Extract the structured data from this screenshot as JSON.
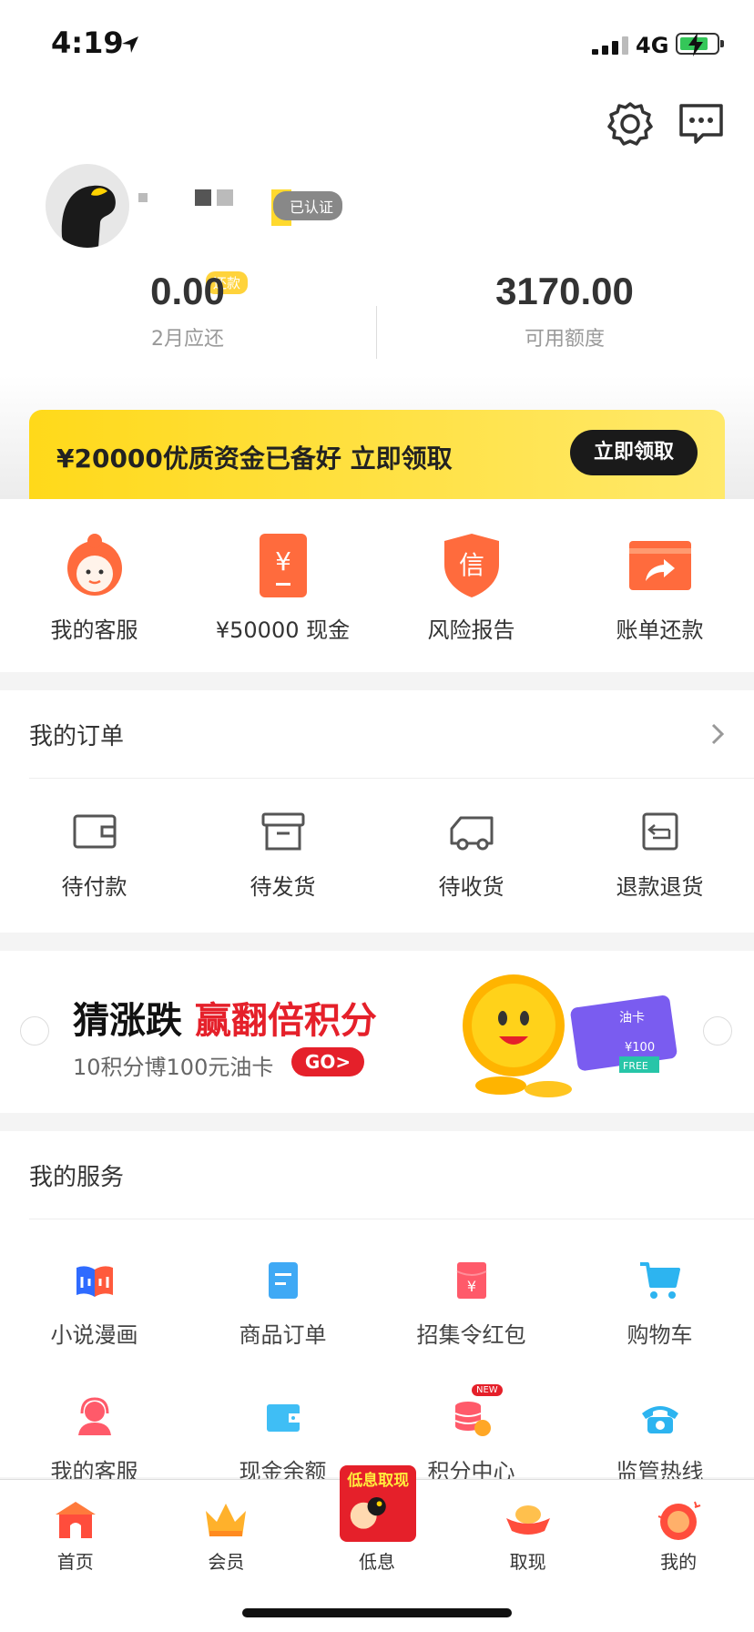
{
  "status_bar": {
    "time": "4:19",
    "network": "4G"
  },
  "profile": {
    "verified_label": "已认证"
  },
  "stats": {
    "repay_badge": "还款",
    "due_amount": "0.00",
    "due_label": "2月应还",
    "credit_amount": "3170.00",
    "credit_label": "可用额度"
  },
  "promo": {
    "text": "¥20000优质资金已备好 立即领取",
    "button": "立即领取"
  },
  "tools": [
    {
      "label": "我的客服",
      "icon": "customer-service-icon"
    },
    {
      "label": "¥50000 现金",
      "icon": "cash-icon"
    },
    {
      "label": "风险报告",
      "icon": "risk-shield-icon"
    },
    {
      "label": "账单还款",
      "icon": "bill-repay-icon"
    }
  ],
  "orders": {
    "title": "我的订单",
    "items": [
      {
        "label": "待付款",
        "icon": "wallet-icon"
      },
      {
        "label": "待发货",
        "icon": "box-icon"
      },
      {
        "label": "待收货",
        "icon": "truck-icon"
      },
      {
        "label": "退款退货",
        "icon": "refund-icon"
      }
    ]
  },
  "banner": {
    "title_black": "猜涨跌 ",
    "title_red": "赢翻倍积分",
    "subtitle": "10积分博100元油卡",
    "go": "GO>",
    "card_label": "油卡",
    "card_amount": "¥100",
    "card_free": "FREE"
  },
  "services": {
    "title": "我的服务",
    "items": [
      {
        "label": "小说漫画",
        "icon": "novel-comic-icon"
      },
      {
        "label": "商品订单",
        "icon": "order-doc-icon"
      },
      {
        "label": "招集令红包",
        "icon": "red-envelope-icon"
      },
      {
        "label": "购物车",
        "icon": "shopping-cart-icon"
      },
      {
        "label": "我的客服",
        "icon": "headset-icon"
      },
      {
        "label": "现金余额",
        "icon": "wallet-balance-icon"
      },
      {
        "label": "积分中心",
        "icon": "points-icon",
        "badge": "NEW"
      },
      {
        "label": "监管热线",
        "icon": "phone-icon"
      }
    ]
  },
  "tabbar": [
    {
      "label": "首页",
      "icon": "home-icon"
    },
    {
      "label": "会员",
      "icon": "crown-icon"
    },
    {
      "label": "低息",
      "icon": "low-interest-icon",
      "promo": "低息取现"
    },
    {
      "label": "取现",
      "icon": "gold-ingot-icon"
    },
    {
      "label": "我的",
      "icon": "profile-icon"
    }
  ],
  "colors": {
    "accent": "#ffd91a",
    "red": "#e5202a",
    "orange": "#ff6b3d"
  }
}
